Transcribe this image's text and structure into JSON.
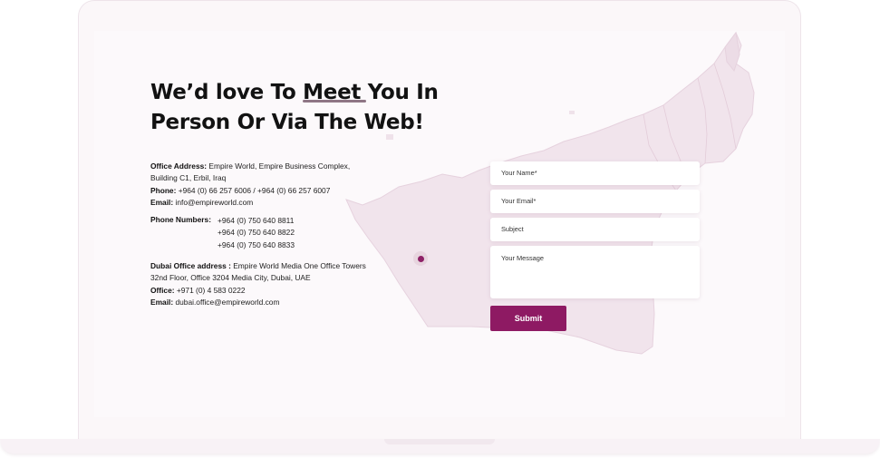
{
  "heading": {
    "line1": "We’d love To Meet You In",
    "line2": "Person Or Via The Web!"
  },
  "office": {
    "address_label": "Office Address:",
    "address_line1": "Empire World, Empire Business Complex,",
    "address_line2": "Building C1, Erbil, Iraq",
    "phone_label": "Phone:",
    "phone_value": "+964 (0) 66 257 6006 / +964 (0) 66 257 6007",
    "email_label": "Email:",
    "email_value": "info@empireworld.com"
  },
  "phones": {
    "label": "Phone Numbers:",
    "numbers": [
      "+964 (0) 750 640 8811",
      "+964 (0) 750 640 8822",
      "+964 (0) 750 640 8833"
    ]
  },
  "dubai": {
    "address_label": "Dubai Office address :",
    "address_line1": "Empire World Media One Office Towers",
    "address_line2": "32nd Floor, Office 3204 Media City, Dubai, UAE",
    "office_label": "Office:",
    "office_value": "+971 (0) 4 583 0222",
    "email_label": "Email:",
    "email_value": "dubai.office@empireworld.com"
  },
  "form": {
    "name_placeholder": "Your Name*",
    "email_placeholder": "Your Email*",
    "subject_placeholder": "Subject",
    "message_placeholder": "Your Message",
    "submit_label": "Submit"
  },
  "colors": {
    "accent": "#8e1a63",
    "map_fill": "#f1e4ec"
  },
  "icons": {
    "map_pin": "location-pin-icon"
  }
}
